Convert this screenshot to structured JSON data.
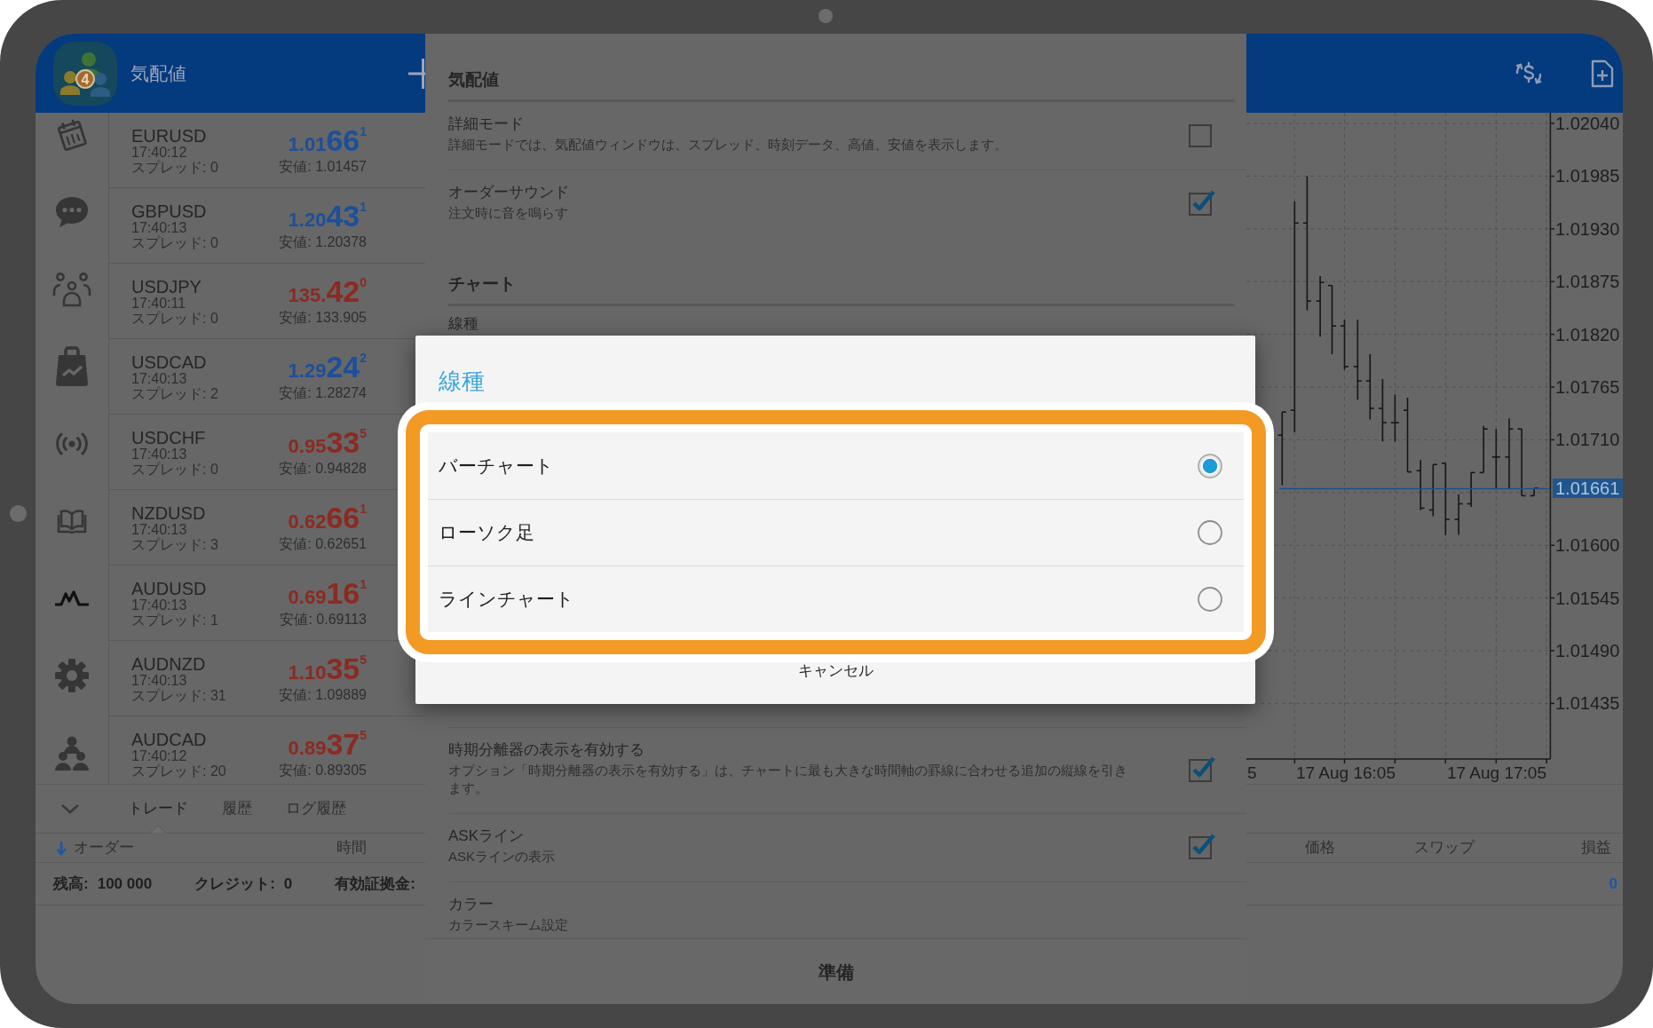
{
  "market_watch": {
    "title": "気配値",
    "logo_badge": "4",
    "quotes": [
      {
        "symbol": "EURUSD",
        "time": "17:40:12",
        "spread": "スプレッド: 0",
        "price_head": "1.01",
        "price_pips": "66",
        "price_point": "1",
        "low": "安値: 1.01457",
        "color": "#1d4f9a"
      },
      {
        "symbol": "GBPUSD",
        "time": "17:40:13",
        "spread": "スプレッド: 0",
        "price_head": "1.20",
        "price_pips": "43",
        "price_point": "1",
        "low": "安値: 1.20378",
        "color": "#1d4f9a"
      },
      {
        "symbol": "USDJPY",
        "time": "17:40:11",
        "spread": "スプレッド: 0",
        "price_head": "135.",
        "price_pips": "42",
        "price_point": "0",
        "low": "安値: 133.905",
        "color": "#8c2a22"
      },
      {
        "symbol": "USDCAD",
        "time": "17:40:13",
        "spread": "スプレッド: 2",
        "price_head": "1.29",
        "price_pips": "24",
        "price_point": "2",
        "low": "安値: 1.28274",
        "color": "#1d4f9a"
      },
      {
        "symbol": "USDCHF",
        "time": "17:40:13",
        "spread": "スプレッド: 0",
        "price_head": "0.95",
        "price_pips": "33",
        "price_point": "5",
        "low": "安値: 0.94828",
        "color": "#8c2a22"
      },
      {
        "symbol": "NZDUSD",
        "time": "17:40:13",
        "spread": "スプレッド: 3",
        "price_head": "0.62",
        "price_pips": "66",
        "price_point": "1",
        "low": "安値: 0.62651",
        "color": "#8c2a22"
      },
      {
        "symbol": "AUDUSD",
        "time": "17:40:13",
        "spread": "スプレッド: 1",
        "price_head": "0.69",
        "price_pips": "16",
        "price_point": "1",
        "low": "安値: 0.69113",
        "color": "#8c2a22"
      },
      {
        "symbol": "AUDNZD",
        "time": "17:40:13",
        "spread": "スプレッド: 31",
        "price_head": "1.10",
        "price_pips": "35",
        "price_point": "5",
        "low": "安値: 1.09889",
        "color": "#8c2a22"
      },
      {
        "symbol": "AUDCAD",
        "time": "17:40:12",
        "spread": "スプレッド: 20",
        "price_head": "0.89",
        "price_pips": "37",
        "price_point": "5",
        "low": "安値: 0.89305",
        "color": "#8c2a22"
      }
    ]
  },
  "settings": {
    "sections": [
      {
        "title": "気配値",
        "items": [
          {
            "kind": "checkbox",
            "title": "詳細モード",
            "description": "詳細モードでは、気配値ウィンドウは、スプレッド、時刻データ、高値、安値を表示します。",
            "checked": false
          },
          {
            "kind": "checkbox",
            "title": "オーダーサウンド",
            "description": "注文時に音を鳴らす",
            "checked": true
          }
        ]
      },
      {
        "title": "チャート",
        "items": [
          {
            "kind": "option",
            "title": "線種"
          },
          {
            "kind": "checkbox",
            "title": "時期分離器の表示を有効する",
            "description": "オプション「時期分離器の表示を有効する」は、チャートに最も大きな時間軸の罫線に合わせる追加の縦線を引きます。",
            "checked": true
          },
          {
            "kind": "checkbox",
            "title": "ASKライン",
            "description": "ASKラインの表示",
            "checked": true
          },
          {
            "kind": "option",
            "title": "カラー",
            "description": "カラースキーム設定"
          }
        ]
      }
    ],
    "button": "準備"
  },
  "dialog": {
    "title": "線種",
    "options": [
      {
        "label": "バーチャート",
        "selected": true
      },
      {
        "label": "ローソク足",
        "selected": false
      },
      {
        "label": "ラインチャート",
        "selected": false
      }
    ],
    "cancel": "キャンセル"
  },
  "chart": {
    "price_labels": [
      "1.02040",
      "1.01985",
      "1.01930",
      "1.01875",
      "1.01820",
      "1.01765",
      "1.01710",
      "1.01600",
      "1.01545",
      "1.01490",
      "1.01435"
    ],
    "current_price": "1.01661",
    "time_labels": [
      "5",
      "17 Aug 16:05",
      "17 Aug 17:05"
    ]
  },
  "terminal": {
    "tabs": [
      {
        "label": "トレード",
        "selected": true
      },
      {
        "label": "履歴",
        "selected": false
      },
      {
        "label": "ログ履歴",
        "selected": false
      }
    ],
    "left_columns": [
      "オーダー",
      "時間"
    ],
    "balance": [
      {
        "label": "残高:",
        "value": "100 000"
      },
      {
        "label": "クレジット:",
        "value": "0"
      },
      {
        "label": "有効証拠金:"
      }
    ],
    "right_columns": [
      "価格",
      "スワップ",
      "損益"
    ],
    "profit": "0"
  }
}
